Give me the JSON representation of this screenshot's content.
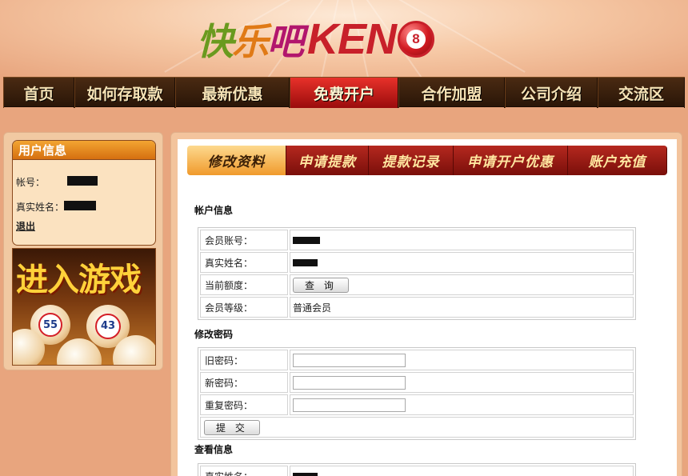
{
  "logo": {
    "cn": [
      "快",
      "乐",
      "吧"
    ],
    "en": "KEN",
    "ball": "8"
  },
  "nav": {
    "items": [
      {
        "label": "首页"
      },
      {
        "label": "如何存取款"
      },
      {
        "label": "最新优惠"
      },
      {
        "label": "免费开户"
      },
      {
        "label": "合作加盟"
      },
      {
        "label": "公司介绍"
      },
      {
        "label": "交流区"
      }
    ],
    "active": 3
  },
  "user": {
    "title": "用户信息",
    "account_label": "帐号：",
    "realname_label": "真实姓名：",
    "logout": "退出"
  },
  "banner": {
    "title": "进入游戏",
    "balls": [
      "55",
      "43"
    ]
  },
  "tabs": {
    "items": [
      {
        "label": "修改资料"
      },
      {
        "label": "申请提款"
      },
      {
        "label": "提款记录"
      },
      {
        "label": "申请开户优惠"
      },
      {
        "label": "账户充值"
      }
    ],
    "active": 0
  },
  "account": {
    "title": "帐户信息",
    "member_label": "会员账号：",
    "realname_label": "真实姓名：",
    "credit_label": "当前额度：",
    "query_button": "查 询",
    "level_label": "会员等级：",
    "level_value": "普通会员"
  },
  "password": {
    "title": "修改密码",
    "old_label": "旧密码：",
    "new_label": "新密码：",
    "repeat_label": "重复密码：",
    "submit": "提 交"
  },
  "view": {
    "title": "查看信息",
    "realname_label": "真实姓名："
  },
  "colors": {
    "nav_bg": "#2a1608",
    "nav_active": "#c8202a",
    "tab_active": "#f09a2c",
    "tab_bg": "#7a0f0a",
    "page_bg": "#e8a57e"
  }
}
